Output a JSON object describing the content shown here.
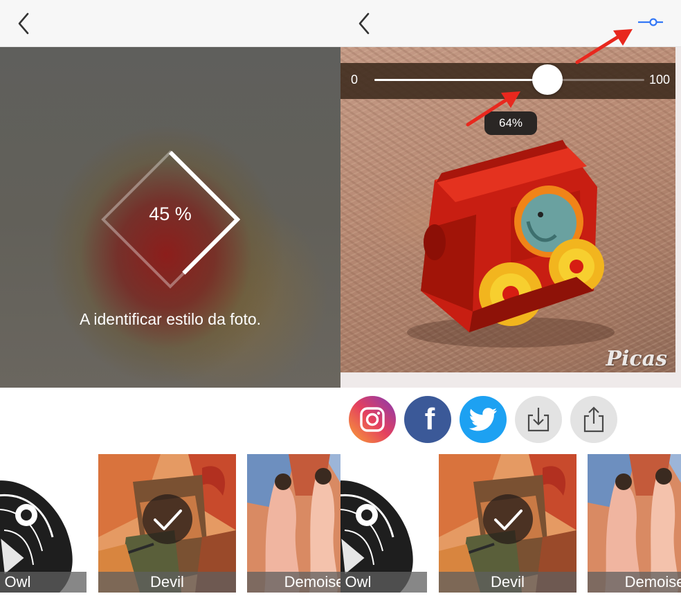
{
  "left_screen": {
    "progress_text": "45 %",
    "progress_value": 0.45,
    "processing_label": "A identificar estilo da foto.",
    "styles": [
      {
        "name": "Owl",
        "selected": false
      },
      {
        "name": "Devil",
        "selected": true
      },
      {
        "name": "Demoisel",
        "selected": false
      }
    ]
  },
  "right_screen": {
    "slider": {
      "min_label": "0",
      "max_label": "100",
      "value": 64,
      "tooltip": "64%"
    },
    "watermark": "Picas",
    "share_buttons": [
      {
        "name": "instagram",
        "icon": "instagram-icon"
      },
      {
        "name": "facebook",
        "icon": "facebook-icon",
        "glyph": "f"
      },
      {
        "name": "twitter",
        "icon": "twitter-bird-icon"
      },
      {
        "name": "download",
        "icon": "download-icon"
      },
      {
        "name": "share",
        "icon": "share-icon"
      }
    ],
    "styles": [
      {
        "name": "Owl",
        "selected": false
      },
      {
        "name": "Devil",
        "selected": true
      },
      {
        "name": "Demoisel",
        "selected": false
      }
    ]
  },
  "colors": {
    "accent_blue": "#3478f6",
    "arrow_red": "#e8281e",
    "instagram_gradient": [
      "#f9a234",
      "#e4405f",
      "#833ab4"
    ],
    "facebook_blue": "#3b5998",
    "twitter_blue": "#1da1f2"
  }
}
